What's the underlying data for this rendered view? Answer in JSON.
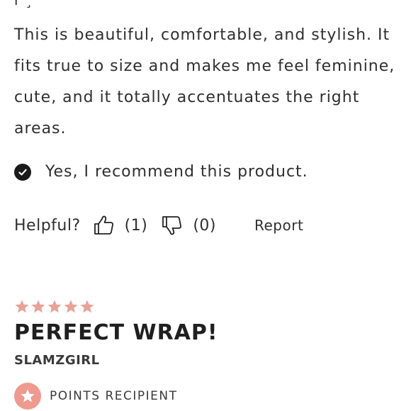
{
  "previous_line_partial": "r  ¸",
  "review_prev": {
    "body": "This is beautiful, comfortable, and stylish. It fits true to size and makes me feel feminine, cute, and it totally accentuates the right areas.",
    "recommend_text": "Yes, I recommend this product.",
    "helpful_label": "Helpful?",
    "upvotes": "(1)",
    "downvotes": "(0)",
    "report_label": "Report"
  },
  "review_next": {
    "rating": 5,
    "rating_max": 5,
    "title": "PERFECT WRAP!",
    "reviewer": "SLAMZGIRL",
    "badge_label": "POINTS RECIPIENT"
  },
  "colors": {
    "star": "#e7a397",
    "badge": "#ee9a8e",
    "check": "#1a1a1a",
    "text": "#2f2f2f"
  },
  "icons": {
    "check": "check-circle-icon",
    "thumbs_up": "thumbs-up-icon",
    "thumbs_down": "thumbs-down-icon",
    "star": "star-icon",
    "badge": "star-badge-icon"
  }
}
